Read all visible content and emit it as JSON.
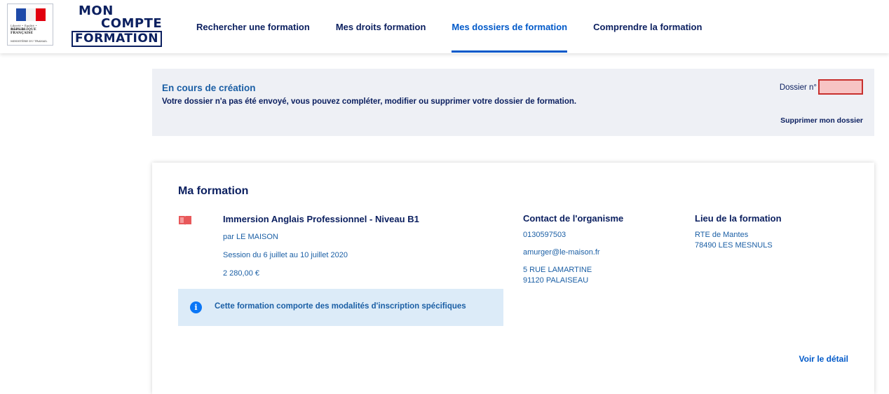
{
  "header": {
    "gov_logo": {
      "motto": "Liberté • Égalité • Fraternité",
      "republique": "RÉPUBLIQUE FRANÇAISE",
      "ministere": "MINISTÈRE DU TRAVAIL"
    },
    "brand": {
      "line1": "MON",
      "line2": "COMPTE",
      "line3": "FORMATION"
    },
    "nav": [
      {
        "label": "Rechercher une formation",
        "active": false
      },
      {
        "label": "Mes droits formation",
        "active": false
      },
      {
        "label": "Mes dossiers de formation",
        "active": true
      },
      {
        "label": "Comprendre la formation",
        "active": false
      }
    ]
  },
  "status": {
    "title": "En cours de création",
    "description": "Votre dossier n'a pas été envoyé, vous pouvez compléter, modifier ou supprimer votre dossier de formation.",
    "dossier_label": "Dossier n°",
    "delete_label": "Supprimer mon dossier"
  },
  "formation": {
    "section_title": "Ma formation",
    "icon": "book-icon",
    "name": "Immersion Anglais Professionnel - Niveau B1",
    "organisme": "par LE MAISON",
    "session": "Session du 6 juillet au 10 juillet 2020",
    "price": "2 280,00 €",
    "info": "Cette formation comporte des modalités d'inscription spécifiques",
    "contact": {
      "title": "Contact de l'organisme",
      "phone": "0130597503",
      "email": "amurger@le-maison.fr",
      "address_line1": "5 RUE LAMARTINE",
      "address_line2": "91120 PALAISEAU"
    },
    "lieu": {
      "title": "Lieu de la formation",
      "address_line1": "RTE de Mantes",
      "address_line2": "78490 LES MESNULS"
    },
    "detail_label": "Voir le détail"
  },
  "colors": {
    "navy": "#0c2060",
    "blue": "#0059c9",
    "link_blue": "#1b5fa5",
    "status_bg": "#eef0f5",
    "info_bg": "#dcebf8",
    "book_icon": "#e8585a",
    "redacted_fill": "#f7c4c4"
  }
}
